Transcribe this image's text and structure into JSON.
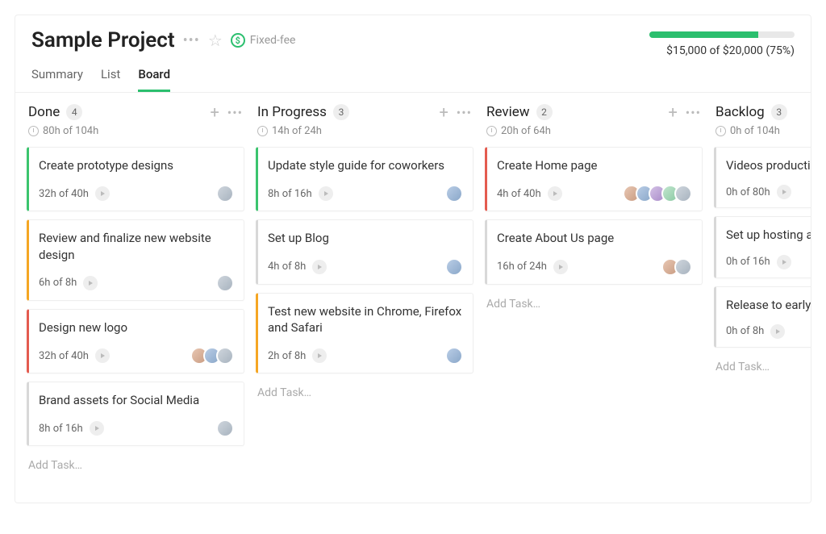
{
  "header": {
    "title": "Sample Project",
    "billing_label": "Fixed-fee",
    "billing_icon_glyph": "$",
    "tabs": [
      {
        "label": "Summary",
        "active": false
      },
      {
        "label": "List",
        "active": false
      },
      {
        "label": "Board",
        "active": true
      }
    ],
    "budget": {
      "spent": "$15,000",
      "total": "$20,000",
      "percent": 75,
      "label": "$15,000 of $20,000 (75%)"
    }
  },
  "add_task_label": "Add Task…",
  "columns": [
    {
      "title": "Done",
      "count": 4,
      "hours": "80h of 104h",
      "cards": [
        {
          "title": "Create prototype designs",
          "hours": "32h of 40h",
          "status": "green",
          "avatars": [
            "a1"
          ]
        },
        {
          "title": "Review and finalize new website design",
          "hours": "6h of 8h",
          "status": "orange",
          "avatars": [
            "a1"
          ]
        },
        {
          "title": "Design new logo",
          "hours": "32h of 40h",
          "status": "red",
          "avatars": [
            "a2",
            "a3",
            "a1"
          ]
        },
        {
          "title": "Brand assets for Social Media",
          "hours": "8h of 16h",
          "status": "gray",
          "avatars": [
            "a1"
          ]
        }
      ]
    },
    {
      "title": "In Progress",
      "count": 3,
      "hours": "14h of 24h",
      "cards": [
        {
          "title": "Update style guide for coworkers",
          "hours": "8h of 16h",
          "status": "green",
          "avatars": [
            "a3"
          ]
        },
        {
          "title": "Set up Blog",
          "hours": "4h of 8h",
          "status": "gray",
          "avatars": [
            "a3"
          ]
        },
        {
          "title": "Test new website in Chrome, Firefox and Safari",
          "hours": "2h of 8h",
          "status": "orange",
          "avatars": [
            "a3"
          ]
        }
      ]
    },
    {
      "title": "Review",
      "count": 2,
      "hours": "20h of 64h",
      "cards": [
        {
          "title": "Create Home page",
          "hours": "4h of 40h",
          "status": "red",
          "avatars": [
            "a2",
            "a3",
            "a4",
            "a5",
            "a1"
          ]
        },
        {
          "title": "Create About Us page",
          "hours": "16h of 24h",
          "status": "gray",
          "avatars": [
            "a2",
            "a1"
          ]
        }
      ]
    },
    {
      "title": "Backlog",
      "count": 3,
      "hours": "0h of 104h",
      "cards": [
        {
          "title": "Videos production",
          "hours": "0h of 80h",
          "status": "gray",
          "avatars": []
        },
        {
          "title": "Set up hosting account",
          "hours": "0h of 16h",
          "status": "gray",
          "avatars": []
        },
        {
          "title": "Release to early adopters",
          "hours": "0h of 8h",
          "status": "gray",
          "avatars": []
        }
      ]
    }
  ]
}
